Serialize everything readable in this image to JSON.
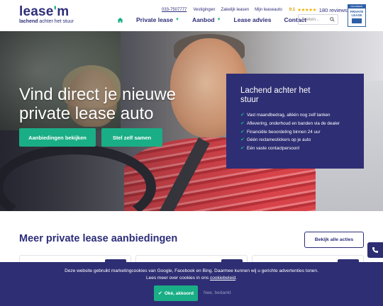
{
  "logo": {
    "word_a": "lease",
    "word_b": "m",
    "tag_bold": "lachend",
    "tag_rest": " achter het stuur"
  },
  "topbar": {
    "phone": "033-7507777",
    "links": [
      "Vestigingen",
      "Zakelijk leasen",
      "Mijn leaseauto"
    ],
    "score": "9.1",
    "stars": "★★★★★",
    "reviews": "180 reviews"
  },
  "badge": {
    "line1": "KEURMERK",
    "line2": "PRIVATE LEASE"
  },
  "nav": {
    "items": [
      "Private lease",
      "Aanbod",
      "Lease advies",
      "Contact"
    ]
  },
  "search": {
    "placeholder": "Zoeken..."
  },
  "hero": {
    "title": "Vind direct je nieuwe private lease auto",
    "btn_primary": "Aanbiedingen bekijken",
    "btn_secondary": "Stel zelf samen"
  },
  "usp": {
    "title": "Lachend achter het stuur",
    "items": [
      "Vast maandbedrag, alléén nog zelf tanken",
      "Aflevering, onderhoud en banden via de dealer",
      "Financiële beoordeling binnen 24 uur",
      "Géén reclamestickers op je auto",
      "Eén vaste contactpersoon!"
    ]
  },
  "section": {
    "title": "Meer private lease aanbiedingen",
    "view_all": "Bekijk alle acties"
  },
  "cookie": {
    "text_1": "Deze website gebruikt marketingcookies van Google, Facebook en Bing. Daarmee kunnen wij u gerichte advertenties tonen.",
    "text_2": "Lees meer over cookies in ons ",
    "link": "cookiebeleid",
    "text_3": ".",
    "accept": "Oké, akkoord",
    "decline": "Nee, bedankt"
  },
  "colors": {
    "brand": "#2e2e74",
    "accent": "#1aae86"
  }
}
